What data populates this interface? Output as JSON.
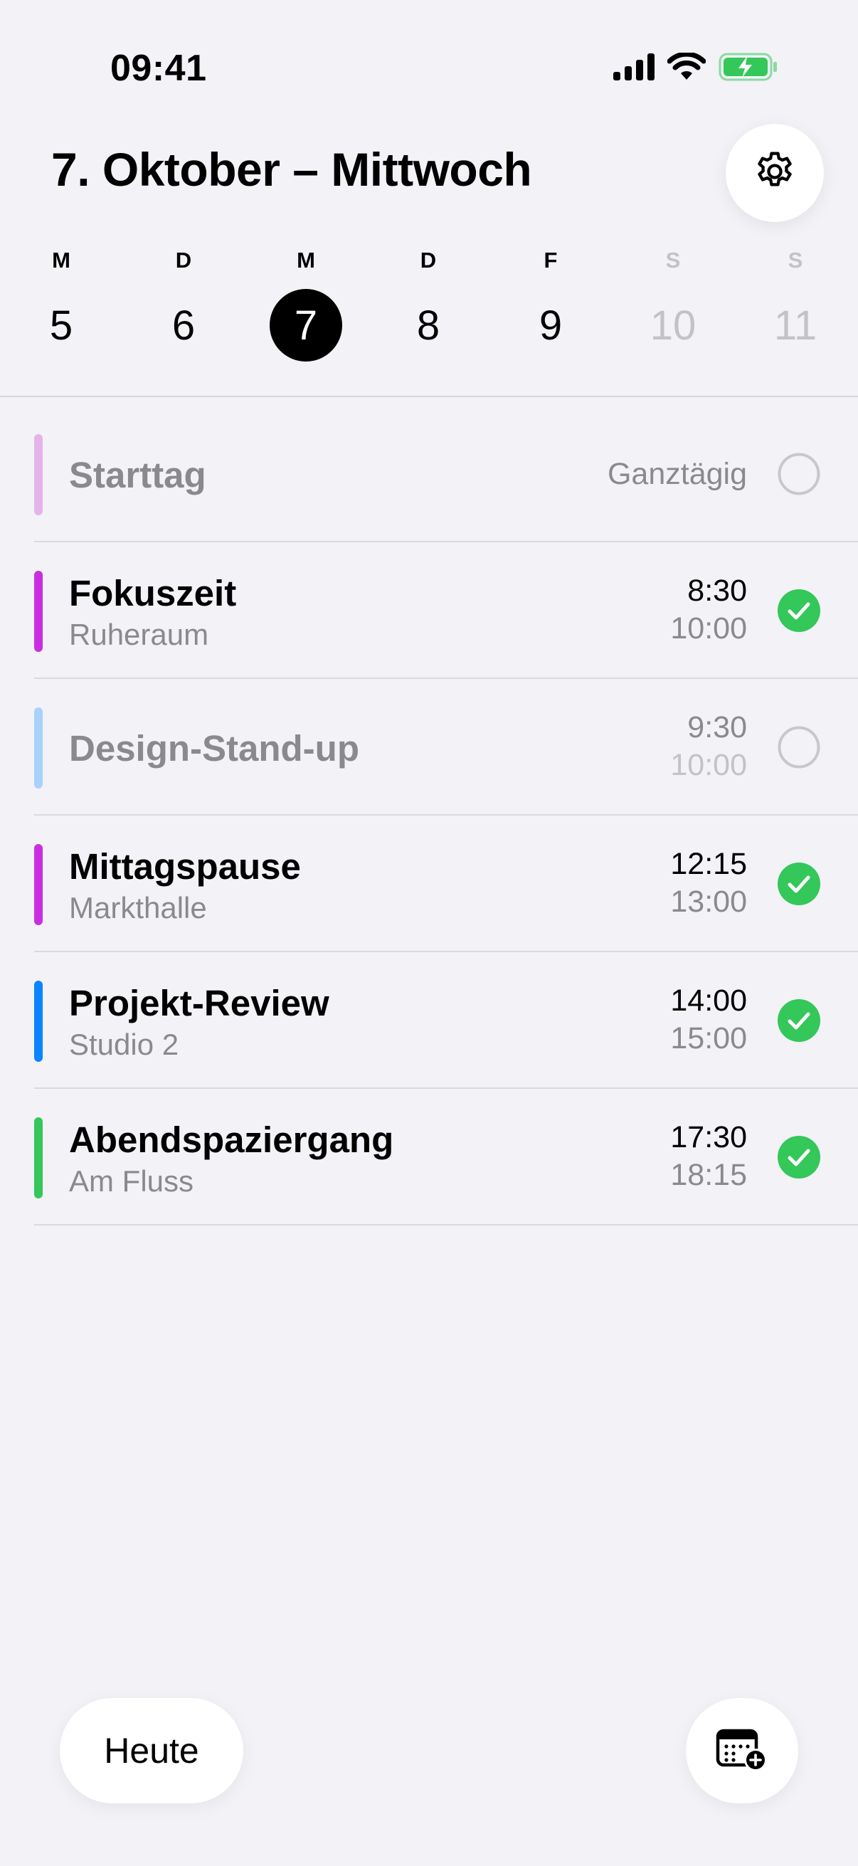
{
  "status_bar": {
    "time": "09:41",
    "icons": [
      "cellular-signal-icon",
      "wifi-icon",
      "battery-charging-icon"
    ],
    "battery_color": "#34c759"
  },
  "header": {
    "title": "7. Oktober – Mittwoch",
    "settings_icon": "gear-icon"
  },
  "week": [
    {
      "letter": "M",
      "number": "5",
      "state": "normal"
    },
    {
      "letter": "D",
      "number": "6",
      "state": "normal"
    },
    {
      "letter": "M",
      "number": "7",
      "state": "selected"
    },
    {
      "letter": "D",
      "number": "8",
      "state": "normal"
    },
    {
      "letter": "F",
      "number": "9",
      "state": "normal"
    },
    {
      "letter": "S",
      "number": "10",
      "state": "weekend"
    },
    {
      "letter": "S",
      "number": "11",
      "state": "weekend"
    }
  ],
  "events": [
    {
      "title": "Starttag",
      "subtitle": "",
      "all_day_label": "Ganztägig",
      "start": "",
      "end": "",
      "color": "#e5b3ec",
      "completed": false,
      "dimmed": true
    },
    {
      "title": "Fokuszeit",
      "subtitle": "Ruheraum",
      "all_day_label": "",
      "start": "8:30",
      "end": "10:00",
      "color": "#c92fe0",
      "completed": true,
      "dimmed": false
    },
    {
      "title": "Design-Stand-up",
      "subtitle": "",
      "all_day_label": "",
      "start": "9:30",
      "end": "10:00",
      "color": "#a8d2fb",
      "completed": false,
      "dimmed": true
    },
    {
      "title": "Mittagspause",
      "subtitle": "Markthalle",
      "all_day_label": "",
      "start": "12:15",
      "end": "13:00",
      "color": "#c92fe0",
      "completed": true,
      "dimmed": false
    },
    {
      "title": "Projekt-Review",
      "subtitle": "Studio 2",
      "all_day_label": "",
      "start": "14:00",
      "end": "15:00",
      "color": "#0a84ff",
      "completed": true,
      "dimmed": false
    },
    {
      "title": "Abendspaziergang",
      "subtitle": "Am Fluss",
      "all_day_label": "",
      "start": "17:30",
      "end": "18:15",
      "color": "#34c759",
      "completed": true,
      "dimmed": false
    }
  ],
  "footer": {
    "today_label": "Heute",
    "add_event_icon": "calendar-add-icon"
  },
  "colors": {
    "background": "#f2f2f7",
    "check_green": "#34c759",
    "secondary_text": "#8a8a8e"
  }
}
